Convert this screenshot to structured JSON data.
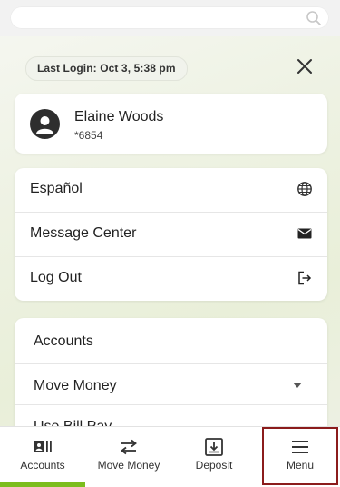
{
  "search": {
    "placeholder": ""
  },
  "session": {
    "last_login": "Last Login: Oct 3, 5:38 pm"
  },
  "profile": {
    "name": "Elaine Woods",
    "account_mask": "*6854"
  },
  "menu": {
    "items": [
      {
        "label": "Español",
        "icon": "globe-icon"
      },
      {
        "label": "Message Center",
        "icon": "envelope-icon"
      },
      {
        "label": "Log Out",
        "icon": "logout-icon"
      }
    ]
  },
  "nav": {
    "items": [
      {
        "label": "Accounts"
      },
      {
        "label": "Move Money"
      },
      {
        "label": "Use Bill Pay"
      }
    ]
  },
  "tabs": [
    {
      "label": "Accounts",
      "icon": "accounts-icon",
      "active": true
    },
    {
      "label": "Move Money",
      "icon": "transfer-arrows-icon"
    },
    {
      "label": "Deposit",
      "icon": "deposit-icon"
    },
    {
      "label": "Menu",
      "icon": "hamburger-icon",
      "highlighted": true
    }
  ],
  "colors": {
    "accent_green": "#7bbd1e",
    "highlight_red": "#8b1c1c"
  }
}
